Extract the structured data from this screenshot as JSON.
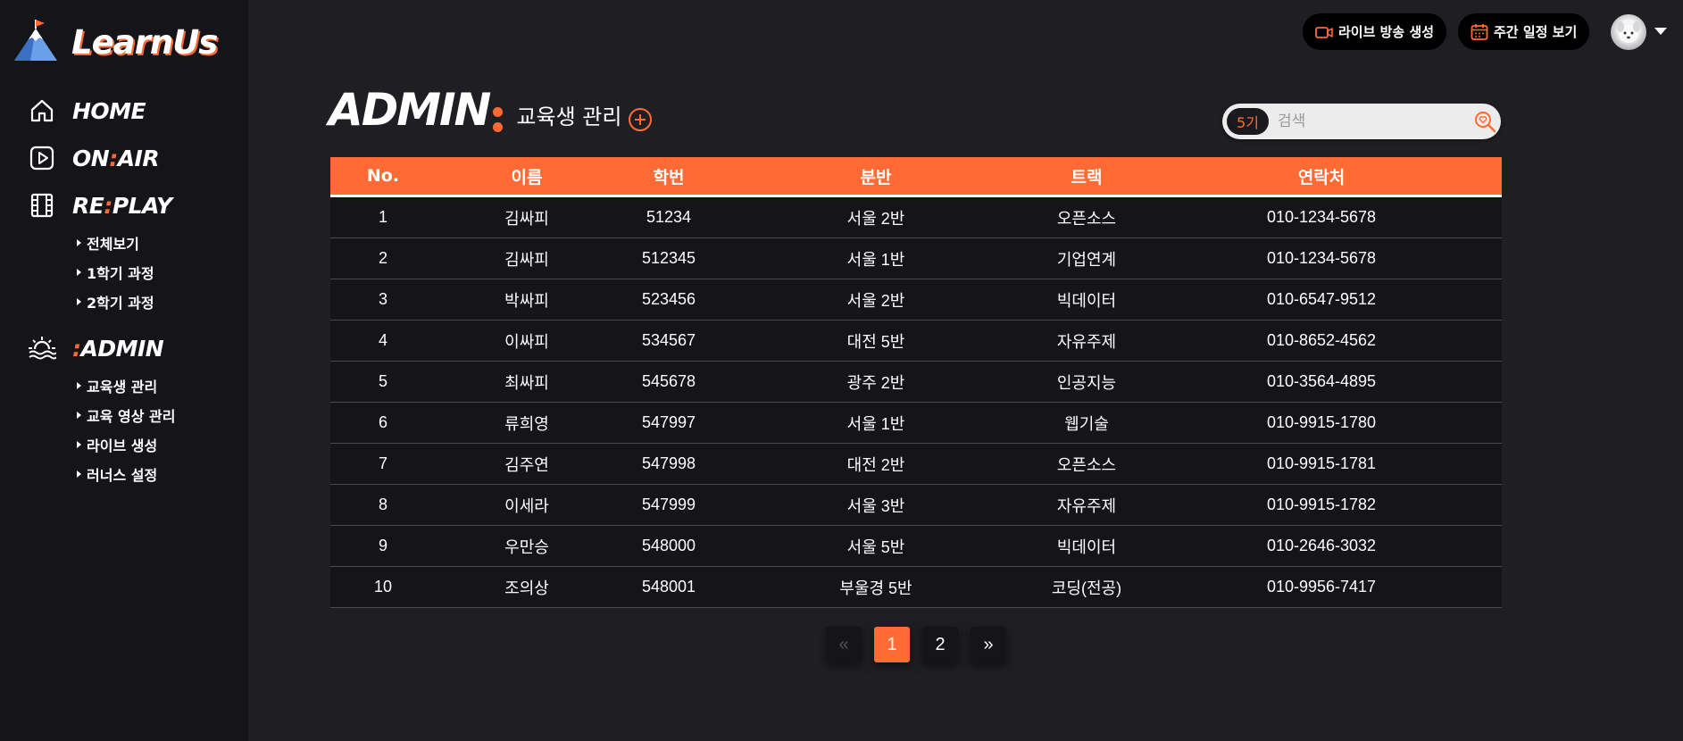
{
  "brand": {
    "name": "LearnUs"
  },
  "sidebar": {
    "nav": [
      {
        "label": "HOME",
        "icon": "home-icon"
      },
      {
        "label_pre": "ON",
        "label_acc": ":",
        "label_post": "AIR",
        "icon": "play-icon"
      },
      {
        "label_pre": "RE",
        "label_acc": ":",
        "label_post": "PLAY",
        "icon": "film-icon",
        "sub": [
          "전체보기",
          "1학기 과정",
          "2학기 과정"
        ]
      },
      {
        "label_pre": "",
        "label_acc": ":",
        "label_post": "ADMIN",
        "icon": "sunrise-icon",
        "sub": [
          "교육생 관리",
          "교육 영상 관리",
          "라이브 생성",
          "러너스 설정"
        ]
      }
    ]
  },
  "topbar": {
    "live_button": "라이브 방송 생성",
    "schedule_button": "주간 일정 보기"
  },
  "page": {
    "title": "ADMIN",
    "subtitle": "교육생 관리"
  },
  "search": {
    "generation": "5기",
    "placeholder": "검색"
  },
  "table": {
    "headers": [
      "No.",
      "이름",
      "학번",
      "분반",
      "트랙",
      "연락처"
    ],
    "rows": [
      [
        "1",
        "김싸피",
        "51234",
        "서울 2반",
        "오픈소스",
        "010-1234-5678"
      ],
      [
        "2",
        "김싸피",
        "512345",
        "서울 1반",
        "기업연계",
        "010-1234-5678"
      ],
      [
        "3",
        "박싸피",
        "523456",
        "서울 2반",
        "빅데이터",
        "010-6547-9512"
      ],
      [
        "4",
        "이싸피",
        "534567",
        "대전 5반",
        "자유주제",
        "010-8652-4562"
      ],
      [
        "5",
        "최싸피",
        "545678",
        "광주 2반",
        "인공지능",
        "010-3564-4895"
      ],
      [
        "6",
        "류희영",
        "547997",
        "서울 1반",
        "웹기술",
        "010-9915-1780"
      ],
      [
        "7",
        "김주연",
        "547998",
        "대전 2반",
        "오픈소스",
        "010-9915-1781"
      ],
      [
        "8",
        "이세라",
        "547999",
        "서울 3반",
        "자유주제",
        "010-9915-1782"
      ],
      [
        "9",
        "우만승",
        "548000",
        "서울 5반",
        "빅데이터",
        "010-2646-3032"
      ],
      [
        "10",
        "조의상",
        "548001",
        "부울경 5반",
        "코딩(전공)",
        "010-9956-7417"
      ]
    ]
  },
  "pagination": {
    "prev": "«",
    "pages": [
      "1",
      "2"
    ],
    "current": "1",
    "next": "»"
  },
  "colors": {
    "accent": "#ff6a35",
    "sidebar": "#141419",
    "background": "#1f1f23"
  }
}
